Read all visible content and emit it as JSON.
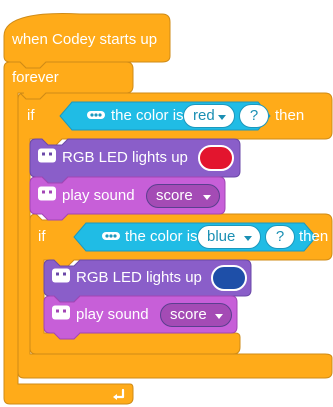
{
  "colors": {
    "control": "#FFAB19",
    "control_stroke": "#CF8B17",
    "sensing": "#20BCE5",
    "sensing_stroke": "#1C98BD",
    "looks": "#8A5EC9",
    "looks_stroke": "#6B48A8",
    "sound": "#C75FD8",
    "sound_stroke": "#A245B4",
    "red_swatch": "#E3152E",
    "blue_swatch": "#1E4FA8"
  },
  "hat": {
    "label": "when Codey starts up"
  },
  "forever": {
    "label": "forever"
  },
  "if1": {
    "if_label": "if",
    "condition": {
      "text": "the color is",
      "value": "red",
      "placeholder": "?"
    },
    "then_label": "then"
  },
  "led1": {
    "label": "RGB LED lights up",
    "color": "red"
  },
  "sound1": {
    "label": "play sound",
    "value": "score"
  },
  "if2": {
    "if_label": "if",
    "condition": {
      "text": "the color is",
      "value": "blue",
      "placeholder": "?"
    },
    "then_label": "then"
  },
  "led2": {
    "label": "RGB LED lights up",
    "color": "blue"
  },
  "sound2": {
    "label": "play sound",
    "value": "score"
  },
  "icons": {
    "sensor": "color-sensor-icon",
    "codey": "codey-face-icon",
    "loop": "loop-arrow-icon"
  }
}
